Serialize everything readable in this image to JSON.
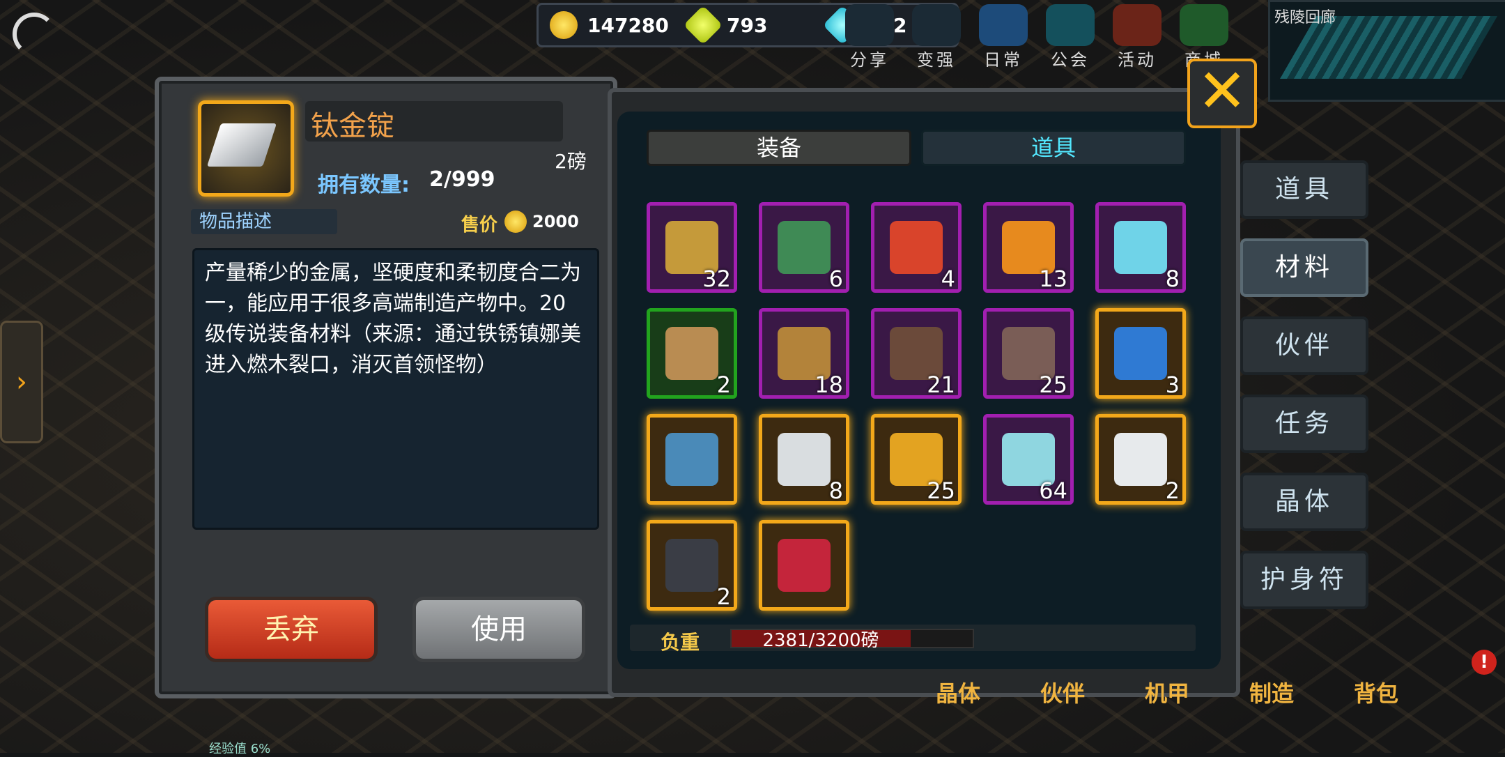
{
  "currency": {
    "gold": "147280",
    "gems_yellow": "793",
    "diamonds": "132"
  },
  "top_nav": [
    "分享",
    "变强",
    "日常",
    "公会",
    "活动",
    "商城"
  ],
  "minimap": {
    "title": "残陵回廊"
  },
  "item": {
    "name": "钛金锭",
    "weight": "2磅",
    "own_label": "拥有数量:",
    "own_value": "2/999",
    "desc_tab": "物品描述",
    "price_label": "售价",
    "price_value": "2000",
    "description": "产量稀少的金属，坚硬度和柔韧度合二为一，能应用于很多高端制造产物中。20级传说装备材料（来源：通过铁锈镇娜美进入燃木裂口，消灭首领怪物）",
    "discard_label": "丢弃",
    "use_label": "使用"
  },
  "tabs": {
    "equipment": "装备",
    "items": "道具"
  },
  "slots": [
    {
      "icon": "gear-blue-icon",
      "count": "32",
      "rarity": "purple"
    },
    {
      "icon": "green-chip-icon",
      "count": "6",
      "rarity": "purple"
    },
    {
      "icon": "red-chip-icon",
      "count": "4",
      "rarity": "purple"
    },
    {
      "icon": "orange-chip-icon",
      "count": "13",
      "rarity": "purple"
    },
    {
      "icon": "energy-cell-icon",
      "count": "8",
      "rarity": "purple"
    },
    {
      "icon": "fuel-can-icon",
      "count": "2",
      "rarity": "green"
    },
    {
      "icon": "skull-coin-icon",
      "count": "18",
      "rarity": "purple"
    },
    {
      "icon": "gear-core-icon",
      "count": "21",
      "rarity": "purple"
    },
    {
      "icon": "gear-disc-icon",
      "count": "25",
      "rarity": "purple"
    },
    {
      "icon": "blue-armor-icon",
      "count": "3",
      "rarity": "orange"
    },
    {
      "icon": "blue-ore-icon",
      "count": "",
      "rarity": "orange"
    },
    {
      "icon": "silver-ingot-icon",
      "count": "8",
      "rarity": "orange"
    },
    {
      "icon": "gold-crystal-icon",
      "count": "25",
      "rarity": "orange"
    },
    {
      "icon": "diamond-icon",
      "count": "64",
      "rarity": "purple"
    },
    {
      "icon": "titanium-ingot-icon",
      "count": "2",
      "rarity": "orange"
    },
    {
      "icon": "dark-ore-icon",
      "count": "2",
      "rarity": "orange"
    },
    {
      "icon": "red-crystal-ore-icon",
      "count": "",
      "rarity": "orange"
    }
  ],
  "weight_bar": {
    "label": "负重",
    "text": "2381/3200磅",
    "fraction": 0.744
  },
  "side_tabs": [
    "道具",
    "材料",
    "伙伴",
    "任务",
    "晶体",
    "护身符"
  ],
  "side_active": "材料",
  "bottom_nav": [
    "晶体",
    "伙伴",
    "机甲",
    "制造",
    "背包"
  ],
  "xp_label": "经验值 6%",
  "colors": {
    "gold": "#f3a81a",
    "purple": "#a21fb0",
    "green": "#22a41e",
    "cyan": "#53e8ff"
  }
}
